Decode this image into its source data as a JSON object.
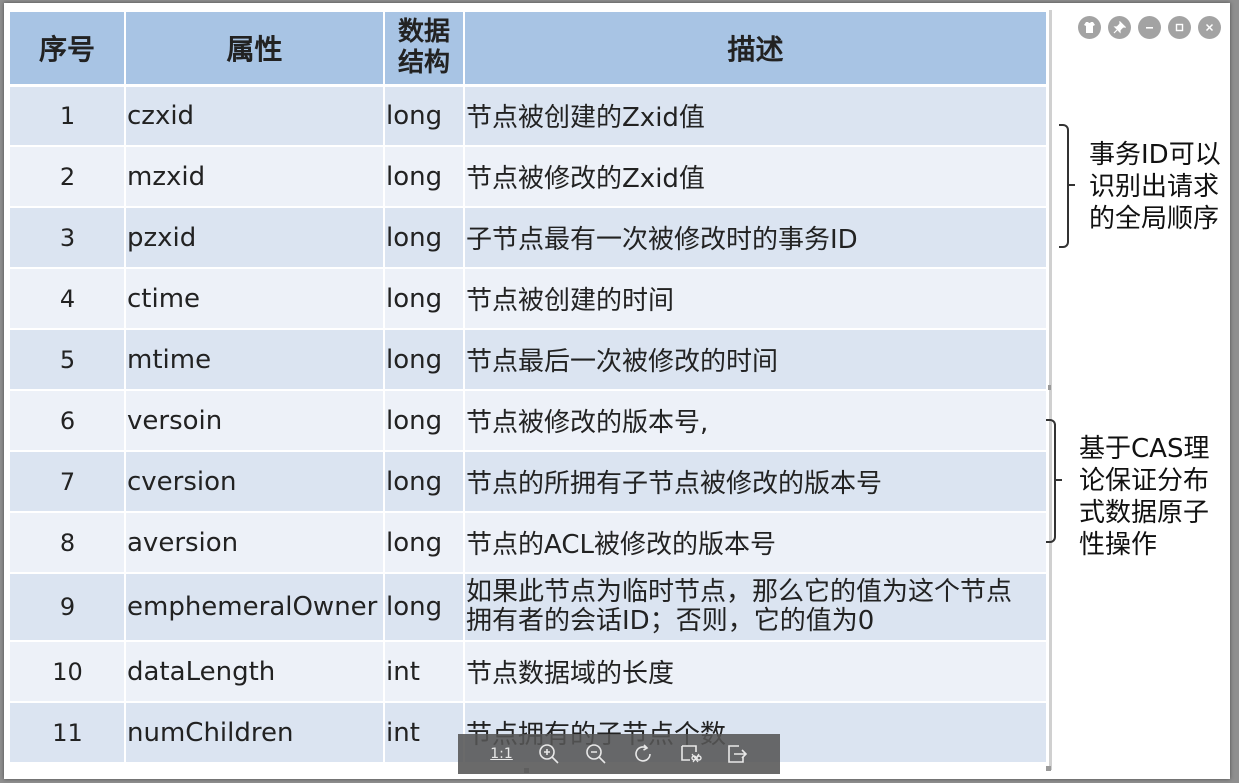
{
  "table": {
    "headers": {
      "num": "序号",
      "attr": "属性",
      "struct_line1": "数据",
      "struct_line2": "结构",
      "desc": "描述"
    },
    "rows": [
      {
        "num": "1",
        "attr": "czxid",
        "type": "long",
        "desc": "节点被创建的Zxid值"
      },
      {
        "num": "2",
        "attr": "mzxid",
        "type": "long",
        "desc": "节点被修改的Zxid值"
      },
      {
        "num": "3",
        "attr": "pzxid",
        "type": "long",
        "desc": "子节点最有一次被修改时的事务ID"
      },
      {
        "num": "4",
        "attr": "ctime",
        "type": "long",
        "desc": "节点被创建的时间"
      },
      {
        "num": "5",
        "attr": "mtime",
        "type": "long",
        "desc": "节点最后一次被修改的时间"
      },
      {
        "num": "6",
        "attr": "versoin",
        "type": "long",
        "desc": "节点被修改的版本号,"
      },
      {
        "num": "7",
        "attr": "cversion",
        "type": "long",
        "desc": "节点的所拥有子节点被修改的版本号"
      },
      {
        "num": "8",
        "attr": "aversion",
        "type": "long",
        "desc": "节点的ACL被修改的版本号"
      },
      {
        "num": "9",
        "attr": "emphemeralOwner",
        "type": "long",
        "desc_line1": "如果此节点为临时节点，那么它的值为这个节点",
        "desc_line2": "拥有者的会话ID；否则，它的值为0"
      },
      {
        "num": "10",
        "attr": "dataLength",
        "type": "int",
        "desc": "节点数据域的长度"
      },
      {
        "num": "11",
        "attr": "numChildren",
        "type": "int",
        "desc": "节点拥有的子节点个数"
      }
    ]
  },
  "notes": {
    "note1": [
      "事务ID可以",
      "识别出请求",
      "的全局顺序"
    ],
    "note2": [
      "基于CAS理",
      "论保证分布",
      "式数据原子",
      "性操作"
    ]
  },
  "window_controls": {
    "icons": [
      "shirt-icon",
      "pin-icon",
      "minimize-icon",
      "maximize-icon",
      "close-icon"
    ]
  },
  "toolbar": {
    "actual_size_label": "1:1",
    "icons": [
      "zoom-in-icon",
      "zoom-out-icon",
      "rotate-icon",
      "crop-icon",
      "export-icon"
    ]
  }
}
